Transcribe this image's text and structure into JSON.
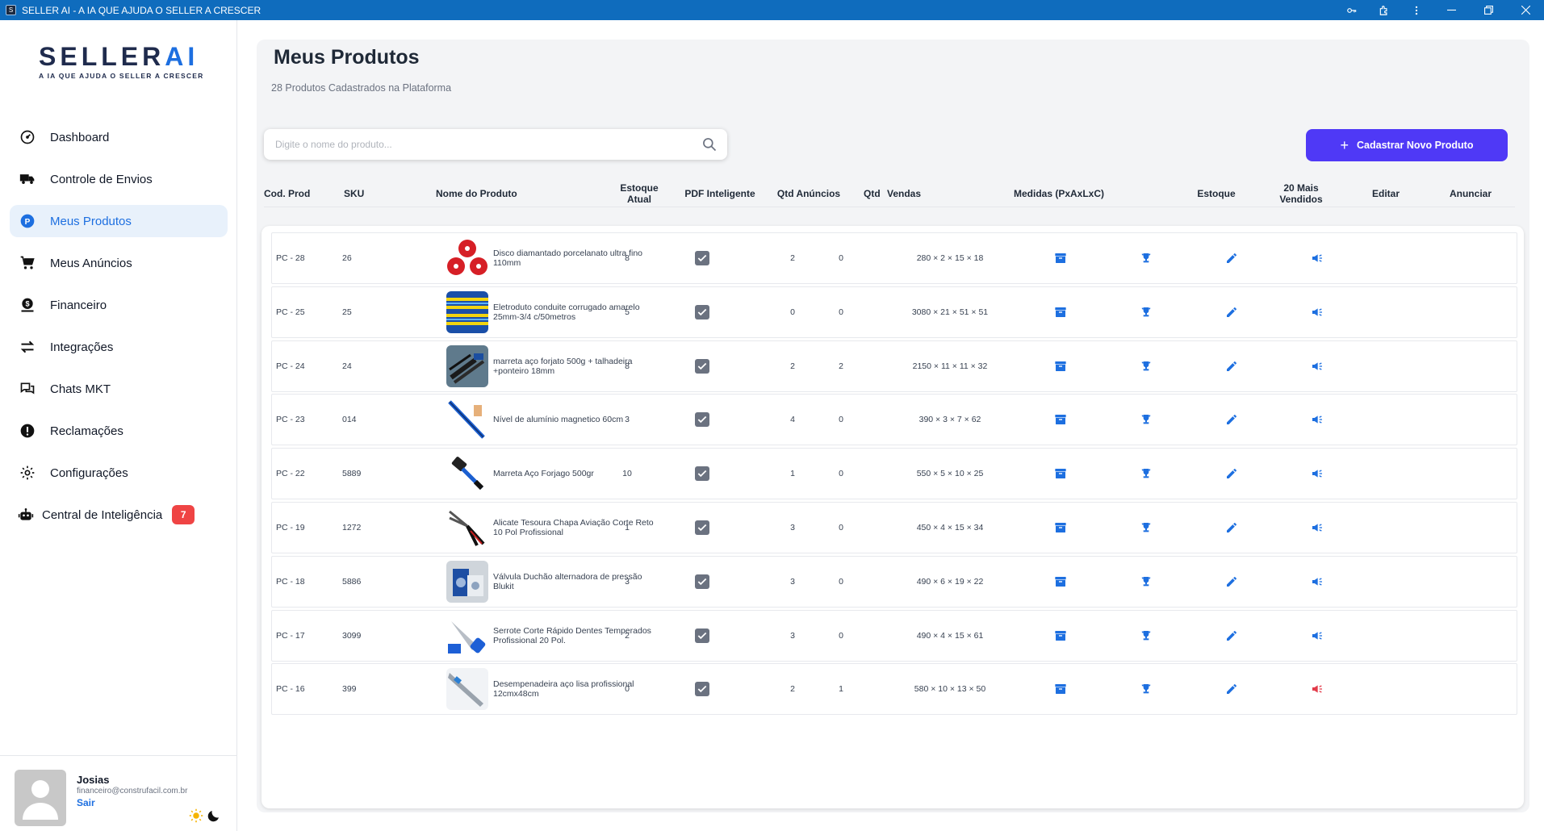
{
  "window": {
    "title": "SELLER AI - A IA QUE AJUDA O SELLER A CRESCER",
    "app_icon": "S",
    "controls": [
      "key-icon",
      "extension-icon",
      "more-vert-icon",
      "minimize-icon",
      "restore-icon",
      "close-icon"
    ]
  },
  "sidebar": {
    "logo": {
      "main": "SELLER",
      "accent": "AI",
      "tagline": "A IA QUE AJUDA O SELLER A CRESCER"
    },
    "items": [
      {
        "label": "Dashboard",
        "icon": "dashboard-gauge-icon"
      },
      {
        "label": "Controle de Envios",
        "icon": "truck-icon"
      },
      {
        "label": "Meus Produtos",
        "icon": "product-p-icon",
        "active": true
      },
      {
        "label": "Meus Anúncios",
        "icon": "cart-icon"
      },
      {
        "label": "Financeiro",
        "icon": "dollar-icon"
      },
      {
        "label": "Integrações",
        "icon": "swap-arrows-icon"
      },
      {
        "label": "Chats MKT",
        "icon": "chat-icon"
      },
      {
        "label": "Reclamações",
        "icon": "alert-icon"
      },
      {
        "label": "Configurações",
        "icon": "gear-icon"
      }
    ],
    "intelligence": {
      "label": "Central de Inteligência",
      "badge": "7",
      "icon": "robot-icon"
    },
    "user": {
      "name": "Josias",
      "email": "financeiro@construfacil.com.br",
      "logout": "Sair"
    }
  },
  "main": {
    "title": "Meus Produtos",
    "subtitle": "28 Produtos Cadastrados na Plataforma",
    "search_placeholder": "Digite o nome do produto...",
    "new_button": "Cadastrar Novo Produto",
    "accent_color": "#4f39f6",
    "link_color": "#1d6fe0",
    "columns": {
      "cod": "Cod. Prod",
      "sku": "SKU",
      "name": "Nome do Produto",
      "stock_line1": "Estoque",
      "stock_line2": "Atual",
      "pdf": "PDF Inteligente",
      "ads": "Qtd Anúncios",
      "qtd": "Qtd",
      "sales": "Vendas",
      "measures": "Medidas (PxAxLxC)",
      "estoque": "Estoque",
      "top_line1": "20 Mais",
      "top_line2": "Vendidos",
      "edit": "Editar",
      "announce": "Anunciar"
    },
    "rows": [
      {
        "cod": "PC - 28",
        "sku": "26",
        "name": "Disco diamantado porcelanato ultra fino 110mm",
        "stock": "8",
        "ads": "2",
        "sales": "0",
        "measures": "280 × 2 × 15 × 18",
        "thumb": "red-discs",
        "announce_color": "#1d6fe0"
      },
      {
        "cod": "PC - 25",
        "sku": "25",
        "name": "Eletroduto conduite corrugado amarelo 25mm-3/4 c/50metros",
        "stock": "5",
        "ads": "0",
        "sales": "0",
        "measures": "3080 × 21 × 51 × 51",
        "thumb": "yellow-conduit",
        "announce_color": "#1d6fe0"
      },
      {
        "cod": "PC - 24",
        "sku": "24",
        "name": "marreta aço forjato 500g + talhadeira +ponteiro 18mm",
        "stock": "8",
        "ads": "2",
        "sales": "2",
        "measures": "2150 × 11 × 11 × 32",
        "thumb": "hammer-set",
        "announce_color": "#1d6fe0"
      },
      {
        "cod": "PC - 23",
        "sku": "014",
        "name": "Nível de alumínio magnetico 60cm",
        "stock": "3",
        "ads": "4",
        "sales": "0",
        "measures": "390 × 3 × 7 × 62",
        "thumb": "level-tool",
        "announce_color": "#1d6fe0"
      },
      {
        "cod": "PC - 22",
        "sku": "5889",
        "name": "Marreta Aço Forjago 500gr",
        "stock": "10",
        "ads": "1",
        "sales": "0",
        "measures": "550 × 5 × 10 × 25",
        "thumb": "sledgehammer",
        "announce_color": "#1d6fe0"
      },
      {
        "cod": "PC - 19",
        "sku": "1272",
        "name": "Alicate Tesoura Chapa Aviação Corte Reto 10 Pol Profissional",
        "stock": "1",
        "ads": "3",
        "sales": "0",
        "measures": "450 × 4 × 15 × 34",
        "thumb": "aviation-snips",
        "announce_color": "#1d6fe0"
      },
      {
        "cod": "PC - 18",
        "sku": "5886",
        "name": "Válvula Duchão alternadora de pressão Blukit",
        "stock": "3",
        "ads": "3",
        "sales": "0",
        "measures": "490 × 6 × 19 × 22",
        "thumb": "valve-box",
        "announce_color": "#1d6fe0"
      },
      {
        "cod": "PC - 17",
        "sku": "3099",
        "name": "Serrote Corte Rápido Dentes Temperados Profissional 20 Pol.",
        "stock": "2",
        "ads": "3",
        "sales": "0",
        "measures": "490 × 4 × 15 × 61",
        "thumb": "hand-saw",
        "announce_color": "#1d6fe0"
      },
      {
        "cod": "PC - 16",
        "sku": "399",
        "name": "Desempenadeira aço lisa profissional 12cmx48cm",
        "stock": "0",
        "ads": "2",
        "sales": "1",
        "measures": "580 × 10 × 13 × 50",
        "thumb": "trowel",
        "announce_color": "#e23b4a"
      }
    ]
  }
}
